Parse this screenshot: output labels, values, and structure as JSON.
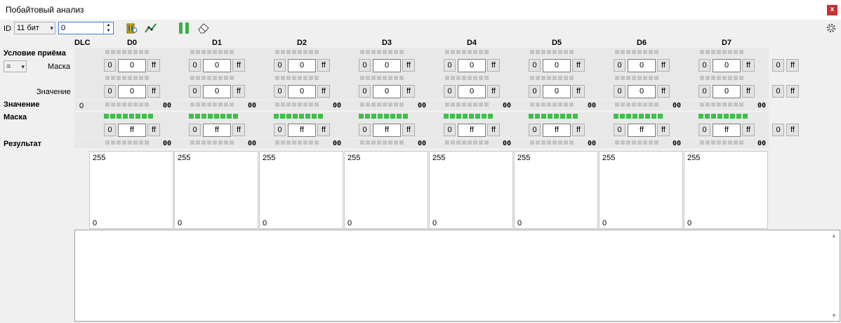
{
  "window": {
    "title": "Побайтовый анализ",
    "close": "x"
  },
  "toolbar": {
    "id_label": "ID",
    "id_type": "11 бит",
    "id_value": "0"
  },
  "columns": {
    "dlc": "DLC",
    "bytes": [
      "D0",
      "D1",
      "D2",
      "D3",
      "D4",
      "D5",
      "D6",
      "D7"
    ]
  },
  "labels": {
    "condition": "Условие приёма",
    "operator": "=",
    "mask": "Маска",
    "value": "Значение",
    "value_row": "Значение",
    "mask_row": "Маска",
    "result": "Результат"
  },
  "condition": {
    "mask_left": "0",
    "mask_field": "0",
    "mask_right": "ff",
    "value_left": "0",
    "value_field": "0",
    "value_right": "ff",
    "extra_left": "0",
    "extra_right": "ff"
  },
  "value_row": {
    "dlc": "0",
    "hex": "00"
  },
  "mask_row": {
    "left": "0",
    "field": "ff",
    "right": "ff",
    "extra_left": "0",
    "extra_right": "ff"
  },
  "result_row": {
    "hex": "00"
  },
  "graphs": {
    "top": "255",
    "bottom": "0"
  },
  "colors": {
    "bit_on": "#3fbf4a",
    "bit_off": "#c4c4c4",
    "close": "#c83232"
  }
}
